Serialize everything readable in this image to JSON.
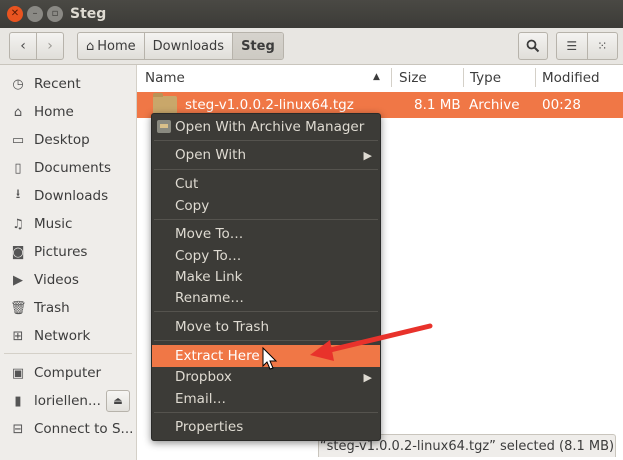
{
  "window": {
    "title": "Steg"
  },
  "toolbar": {
    "breadcrumbs": [
      "Home",
      "Downloads",
      "Steg"
    ]
  },
  "sidebar": {
    "items": [
      {
        "label": "Recent",
        "icon": "clock-icon"
      },
      {
        "label": "Home",
        "icon": "home-icon"
      },
      {
        "label": "Desktop",
        "icon": "folder-icon"
      },
      {
        "label": "Documents",
        "icon": "document-icon"
      },
      {
        "label": "Downloads",
        "icon": "download-icon"
      },
      {
        "label": "Music",
        "icon": "music-icon"
      },
      {
        "label": "Pictures",
        "icon": "camera-icon"
      },
      {
        "label": "Videos",
        "icon": "video-icon"
      },
      {
        "label": "Trash",
        "icon": "trash-icon"
      },
      {
        "label": "Network",
        "icon": "network-icon"
      }
    ],
    "devices": [
      {
        "label": "Computer",
        "icon": "computer-icon"
      },
      {
        "label": "loriellen...",
        "icon": "drive-icon"
      },
      {
        "label": "Connect to S...",
        "icon": "server-icon"
      }
    ]
  },
  "columns": {
    "name": "Name",
    "size": "Size",
    "type": "Type",
    "modified": "Modified"
  },
  "file": {
    "name": "steg-v1.0.0.2-linux64.tgz",
    "size": "8.1 MB",
    "type": "Archive",
    "modified": "00:28"
  },
  "context_menu": {
    "items": [
      "Open With Archive Manager",
      "Open With",
      "Cut",
      "Copy",
      "Move To…",
      "Copy To…",
      "Make Link",
      "Rename…",
      "Move to Trash",
      "Extract Here",
      "Dropbox",
      "Email…",
      "Properties"
    ],
    "highlighted": "Extract Here"
  },
  "status": {
    "text": "“steg-v1.0.0.2-linux64.tgz” selected  (8.1 MB)"
  },
  "colors": {
    "accent": "#f07746",
    "menu_bg": "#3c3b37",
    "close_button": "#e95420",
    "annotation_arrow": "#e8322b"
  }
}
